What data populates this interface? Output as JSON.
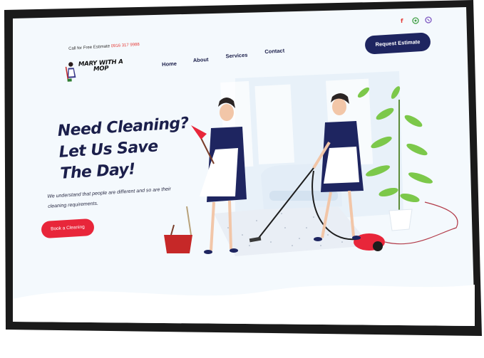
{
  "header": {
    "call_prefix": "Call for Free Estimate",
    "phone": "0916 317 9988",
    "logo_text": "MARY WITH A MOP",
    "nav": [
      "Home",
      "About",
      "Services",
      "Contact"
    ],
    "cta_label": "Request Estimate",
    "social_icons": [
      "facebook-icon",
      "whatsapp-icon",
      "viber-icon"
    ]
  },
  "hero": {
    "headline_lines": [
      "Need Cleaning?",
      "Let Us Save",
      "The Day!"
    ],
    "lead": "We understand that people are different and so are their cleaning requirements.",
    "button_label": "Book a Cleaning"
  },
  "colors": {
    "navy": "#1e2560",
    "accent_red": "#e8263a",
    "heading": "#1b1f4b",
    "page_bg": "#f2f8fc",
    "plant": "#7cc84a"
  }
}
